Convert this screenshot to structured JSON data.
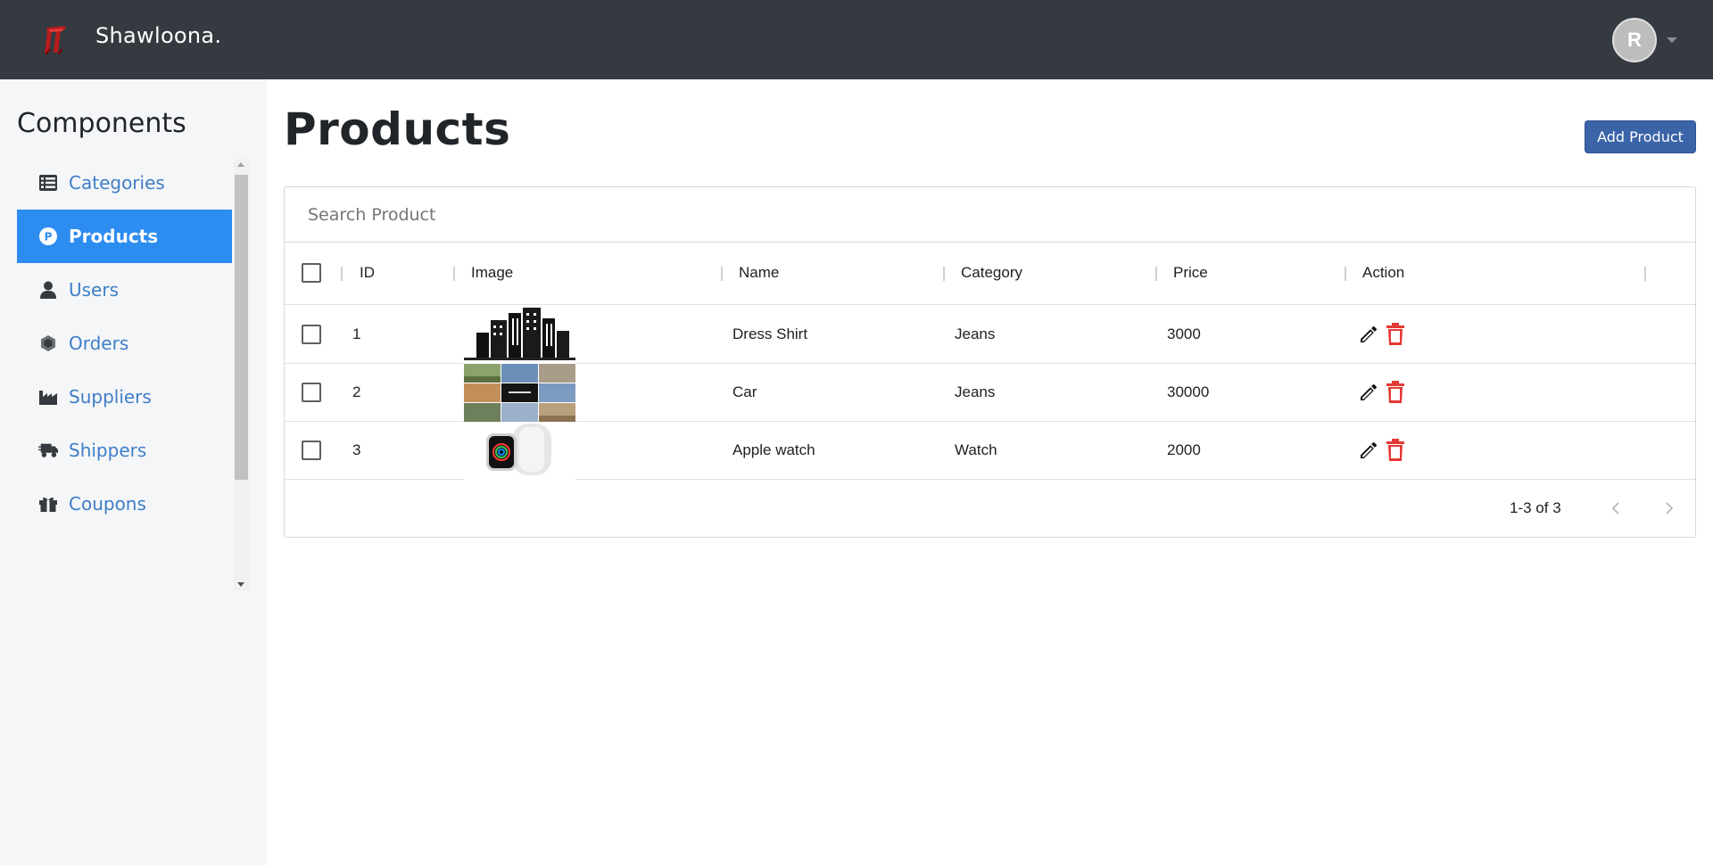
{
  "header": {
    "brand_name": "Shawloona.",
    "logo_icon": "brand-logo-icon",
    "avatar_initial": "R"
  },
  "sidebar": {
    "title": "Components",
    "items": [
      {
        "label": "Categories",
        "icon": "list-icon",
        "active": false
      },
      {
        "label": "Products",
        "icon": "product-p-icon",
        "active": true
      },
      {
        "label": "Users",
        "icon": "user-icon",
        "active": false
      },
      {
        "label": "Orders",
        "icon": "box-icon",
        "active": false
      },
      {
        "label": "Suppliers",
        "icon": "factory-icon",
        "active": false
      },
      {
        "label": "Shippers",
        "icon": "truck-icon",
        "active": false
      },
      {
        "label": "Coupons",
        "icon": "gift-icon",
        "active": false
      }
    ]
  },
  "main": {
    "title": "Products",
    "add_button": "Add Product",
    "search_placeholder": "Search Product",
    "search_value": "",
    "columns": [
      "ID",
      "Image",
      "Name",
      "Category",
      "Price",
      "Action"
    ],
    "rows": [
      {
        "id": "1",
        "image": "city-buildings-image",
        "name": "Dress Shirt",
        "category": "Jeans",
        "price": "3000"
      },
      {
        "id": "2",
        "image": "pakistan-collage-image",
        "name": "Car",
        "category": "Jeans",
        "price": "30000"
      },
      {
        "id": "3",
        "image": "apple-watch-image",
        "name": "Apple watch",
        "category": "Watch",
        "price": "2000"
      }
    ],
    "pagination": "1-3 of 3"
  },
  "colors": {
    "topbar": "#343a40",
    "sidebar_bg": "#f5f6f8",
    "active_item": "#2d8cf0",
    "link": "#3e7ec8",
    "primary_button": "#3a64a7",
    "delete_icon": "#e53935"
  }
}
